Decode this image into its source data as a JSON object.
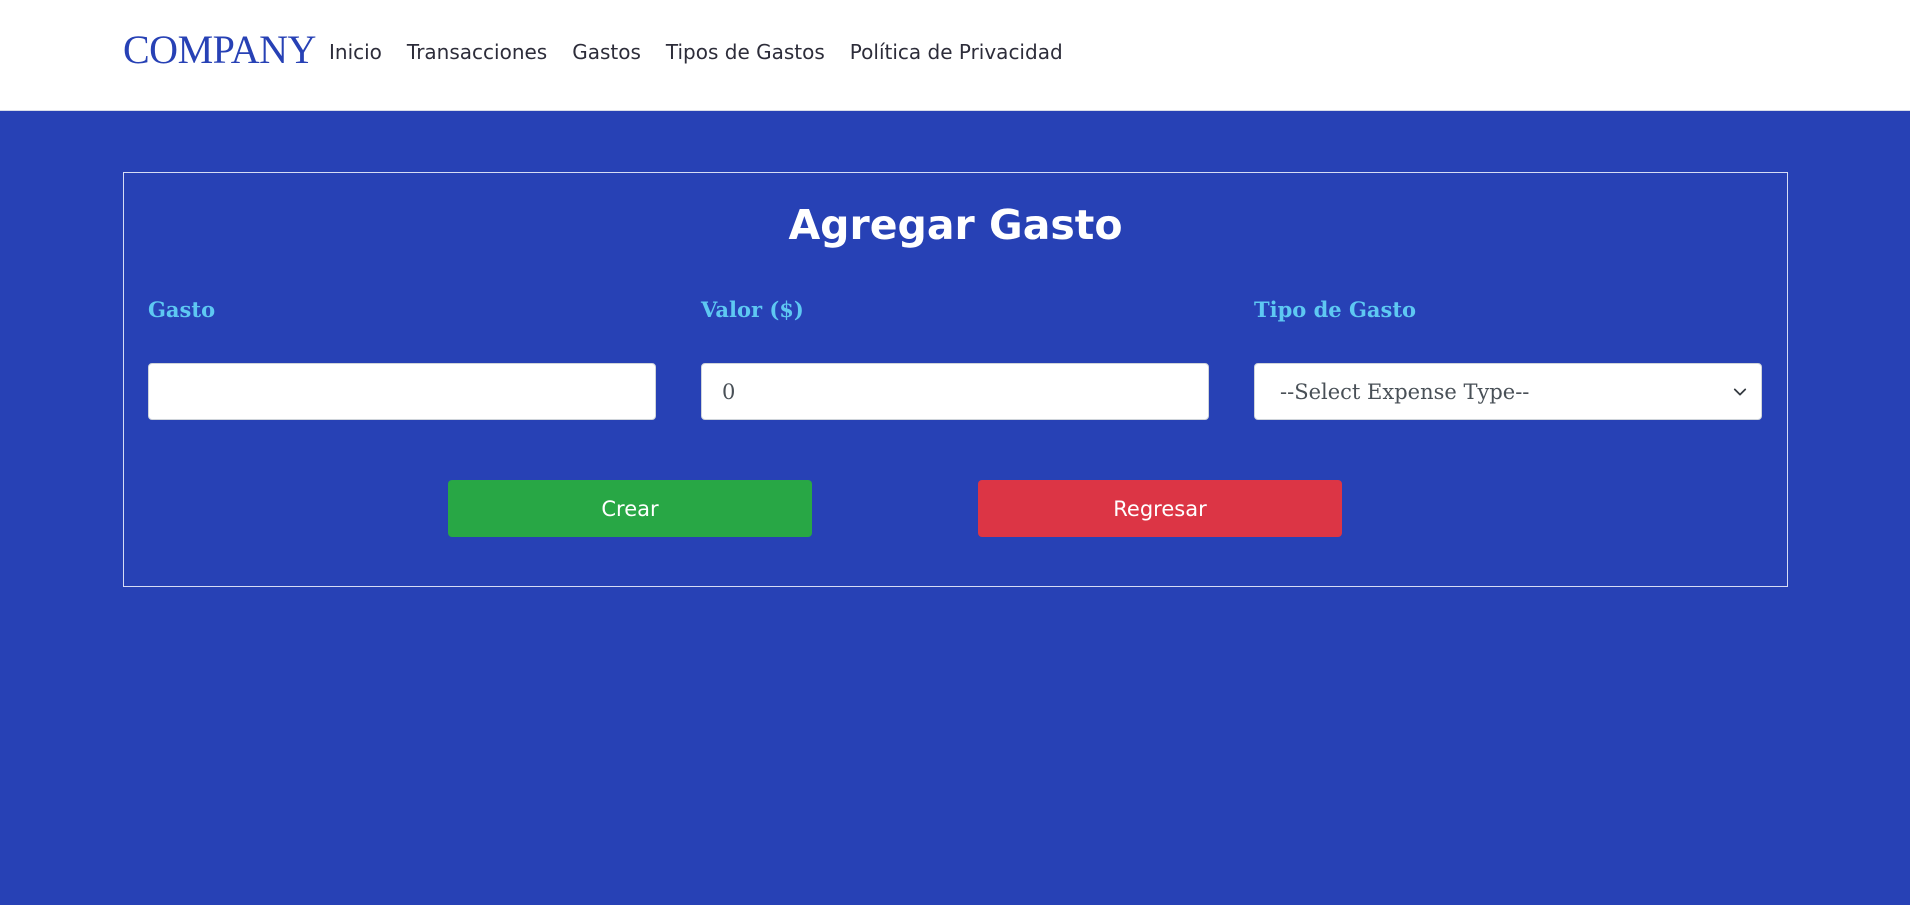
{
  "navbar": {
    "brand": "COMPANY",
    "links": [
      "Inicio",
      "Transacciones",
      "Gastos",
      "Tipos de Gastos",
      "Política de Privacidad"
    ]
  },
  "form": {
    "title": "Agregar Gasto",
    "fields": {
      "gasto": {
        "label": "Gasto",
        "value": ""
      },
      "valor": {
        "label": "Valor ($)",
        "value": "0"
      },
      "tipo": {
        "label": "Tipo de Gasto",
        "selected": "--Select Expense Type--"
      }
    },
    "buttons": {
      "create": "Crear",
      "back": "Regresar"
    }
  },
  "colors": {
    "page_background": "#2741b5",
    "label": "#5ec8f2",
    "create_button": "#28a745",
    "back_button": "#dc3545"
  },
  "icons": {
    "select_caret": "chevron-down-icon"
  }
}
